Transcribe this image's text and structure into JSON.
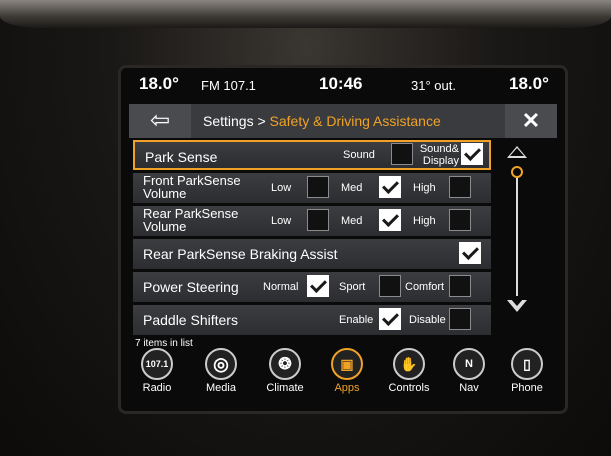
{
  "status": {
    "temp_left": "18.0°",
    "radio": "FM 107.1",
    "clock": "10:46",
    "outside": "31° out.",
    "temp_right": "18.0°"
  },
  "title": {
    "breadcrumb_root": "Settings > ",
    "breadcrumb_sub": "Safety & Driving Assistance"
  },
  "rows": {
    "park_sense": {
      "label": "Park Sense",
      "opt1": "Sound",
      "opt2": "Sound& Display",
      "opt1_checked": false,
      "opt2_checked": true
    },
    "front": {
      "label_l1": "Front ParkSense",
      "label_l2": "Volume",
      "low": "Low",
      "med": "Med",
      "high": "High",
      "selected": "Med"
    },
    "rear": {
      "label_l1": "Rear ParkSense",
      "label_l2": "Volume",
      "low": "Low",
      "med": "Med",
      "high": "High",
      "selected": "Med"
    },
    "braking": {
      "label": "Rear ParkSense Braking Assist",
      "checked": true
    },
    "steering": {
      "label": "Power Steering",
      "normal": "Normal",
      "sport": "Sport",
      "comfort": "Comfort",
      "selected": "Normal"
    },
    "paddle": {
      "label": "Paddle Shifters",
      "enable": "Enable",
      "disable": "Disable",
      "selected": "Enable"
    }
  },
  "list_count": "7 items in list",
  "nav": [
    {
      "label": "Radio",
      "icon": "radio-icon",
      "glyph": "107.1"
    },
    {
      "label": "Media",
      "icon": "media-icon",
      "glyph": "◎"
    },
    {
      "label": "Climate",
      "icon": "climate-icon",
      "glyph": "❂"
    },
    {
      "label": "Apps",
      "icon": "apps-icon",
      "glyph": "▣"
    },
    {
      "label": "Controls",
      "icon": "controls-icon",
      "glyph": "✋"
    },
    {
      "label": "Nav",
      "icon": "nav-icon",
      "glyph": "N"
    },
    {
      "label": "Phone",
      "icon": "phone-icon",
      "glyph": "▯"
    }
  ],
  "active_nav": "Apps",
  "colors": {
    "accent": "#f0a227",
    "row_bg": "#3c3d40"
  }
}
